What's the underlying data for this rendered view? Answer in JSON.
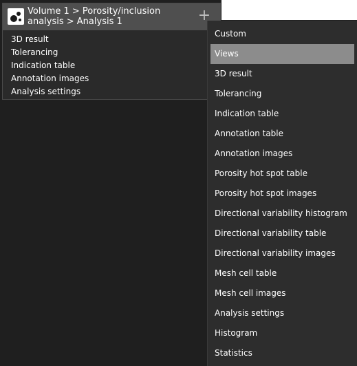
{
  "panel": {
    "title": "Volume 1 > Porosity/inclusion analysis > Analysis 1",
    "add_label": "+",
    "items": [
      {
        "label": "3D result"
      },
      {
        "label": "Tolerancing"
      },
      {
        "label": "Indication table"
      },
      {
        "label": "Annotation images"
      },
      {
        "label": "Analysis settings"
      }
    ]
  },
  "menu": {
    "selected_index": 1,
    "items": [
      {
        "label": "Custom"
      },
      {
        "label": "Views"
      },
      {
        "label": "3D result"
      },
      {
        "label": "Tolerancing"
      },
      {
        "label": "Indication table"
      },
      {
        "label": "Annotation table"
      },
      {
        "label": "Annotation images"
      },
      {
        "label": "Porosity hot spot table"
      },
      {
        "label": "Porosity hot spot images"
      },
      {
        "label": "Directional variability histogram"
      },
      {
        "label": "Directional variability table"
      },
      {
        "label": "Directional variability images"
      },
      {
        "label": "Mesh cell table"
      },
      {
        "label": "Mesh cell images"
      },
      {
        "label": "Analysis settings"
      },
      {
        "label": "Histogram"
      },
      {
        "label": "Statistics"
      }
    ]
  },
  "icons": {
    "panel_icon": "porosity-analysis-icon",
    "add_icon": "plus-icon"
  },
  "colors": {
    "background": "#1f1f1f",
    "panel_header": "#4f4f4f",
    "menu_background": "#2d2d2d",
    "menu_selected": "#8c8c8c"
  }
}
